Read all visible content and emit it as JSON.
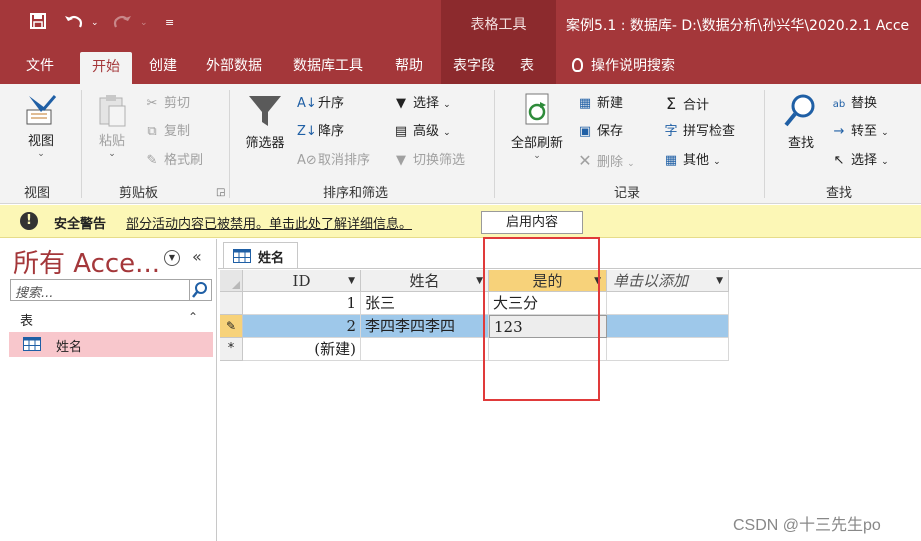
{
  "titlebar": {
    "context_tools": "表格工具",
    "doc_title": "案例5.1 : 数据库- D:\\数据分析\\孙兴华\\2020.2.1 Acce"
  },
  "tabs": {
    "file": "文件",
    "home": "开始",
    "create": "创建",
    "external": "外部数据",
    "dbtools": "数据库工具",
    "help": "帮助",
    "fields": "表字段",
    "table": "表",
    "tellme": "操作说明搜索"
  },
  "ribbon": {
    "view": {
      "button": "视图",
      "group": "视图"
    },
    "clipboard": {
      "paste": "粘贴",
      "cut": "剪切",
      "copy": "复制",
      "format_painter": "格式刷",
      "group": "剪贴板"
    },
    "sort": {
      "filter": "筛选器",
      "asc": "升序",
      "desc": "降序",
      "remove_sort": "取消排序",
      "selection": "选择",
      "advanced": "高级",
      "toggle_filter": "切换筛选",
      "group": "排序和筛选"
    },
    "records": {
      "refresh": "全部刷新",
      "new": "新建",
      "save": "保存",
      "delete": "删除",
      "totals": "合计",
      "spelling": "拼写检查",
      "more": "其他",
      "group": "记录"
    },
    "find": {
      "find": "查找",
      "replace": "替换",
      "goto": "转至",
      "select": "选择",
      "group": "查找"
    }
  },
  "warning": {
    "title": "安全警告",
    "message": "部分活动内容已被禁用。单击此处了解详细信息。",
    "button": "启用内容"
  },
  "nav": {
    "title": "所有 Acce...",
    "search_placeholder": "搜索...",
    "category": "表",
    "items": [
      {
        "label": "姓名"
      }
    ]
  },
  "object_tab": "姓名",
  "datasheet": {
    "columns": [
      "ID",
      "姓名",
      "是的",
      "单击以添加"
    ],
    "rows": [
      {
        "id": "1",
        "name": "张三",
        "shide": "大三分"
      },
      {
        "id": "2",
        "name": "李四李四李四",
        "shide": "123"
      }
    ],
    "new_row": "(新建)",
    "new_row_marker": "*"
  },
  "watermark": "CSDN @十三先生po",
  "colors": {
    "accent": "#a4373a",
    "selection": "#9ec8ea",
    "warning": "#fcf7b6",
    "active_header": "#f7d27a"
  }
}
